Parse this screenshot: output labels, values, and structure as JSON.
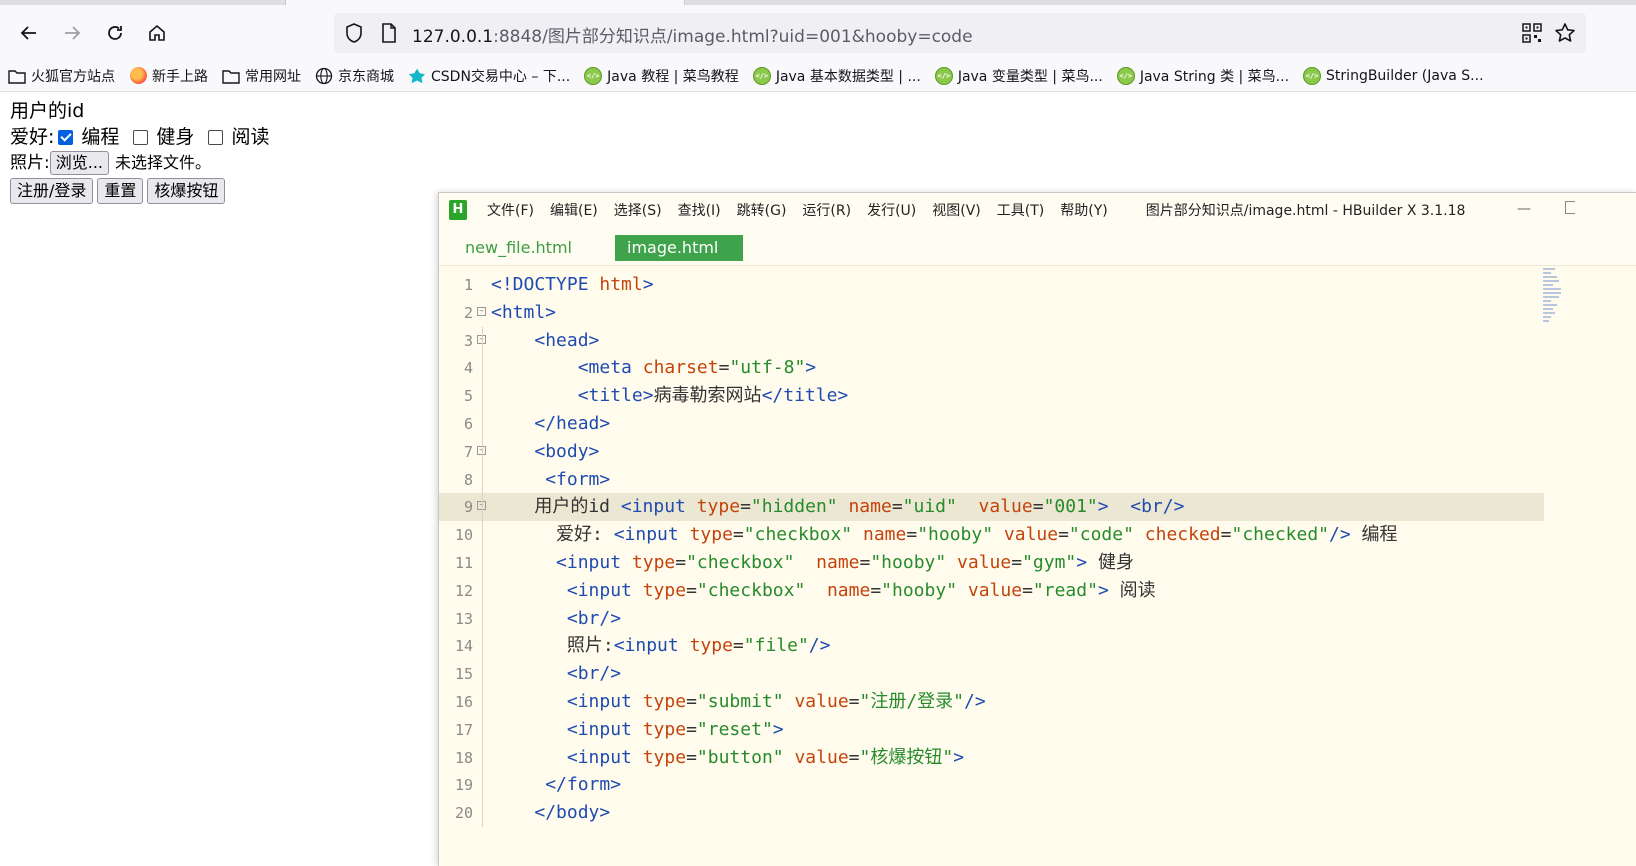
{
  "browser": {
    "url_host": "127.0.0.1",
    "url_rest": ":8848/图片部分知识点/image.html?uid=001&hooby=code",
    "bookmarks": [
      {
        "label": "火狐官方站点",
        "icon": "folder-icon"
      },
      {
        "label": "新手上路",
        "icon": "firefox-icon"
      },
      {
        "label": "常用网址",
        "icon": "folder-icon"
      },
      {
        "label": "京东商城",
        "icon": "globe-icon"
      },
      {
        "label": "CSDN交易中心 – 下...",
        "icon": "csdn-icon"
      },
      {
        "label": "Java 教程 | 菜鸟教程",
        "icon": "runoob-icon"
      },
      {
        "label": "Java 基本数据类型 | ...",
        "icon": "runoob-icon"
      },
      {
        "label": "Java 变量类型 | 菜鸟...",
        "icon": "runoob-icon"
      },
      {
        "label": "Java String 类 | 菜鸟...",
        "icon": "runoob-icon"
      },
      {
        "label": "StringBuilder (Java S...",
        "icon": "runoob-icon"
      }
    ]
  },
  "page": {
    "user_id_label": "用户的id",
    "hobby_label": "爱好:",
    "hobbies": [
      {
        "label": "编程",
        "checked": true
      },
      {
        "label": "健身",
        "checked": false
      },
      {
        "label": "阅读",
        "checked": false
      }
    ],
    "photo_label": "照片:",
    "browse_button": "浏览...",
    "no_file_text": "未选择文件。",
    "submit_button": "注册/登录",
    "reset_button": "重置",
    "nuke_button": "核爆按钮"
  },
  "editor": {
    "logo": "H",
    "menus": [
      "文件(F)",
      "编辑(E)",
      "选择(S)",
      "查找(I)",
      "跳转(G)",
      "运行(R)",
      "发行(U)",
      "视图(V)",
      "工具(T)",
      "帮助(Y)"
    ],
    "window_title": "图片部分知识点/image.html - HBuilder X 3.1.18",
    "minimize_glyph": "—",
    "tabs": [
      "new_file.html",
      "image.html"
    ],
    "active_tab": 1,
    "highlighted_line": 9,
    "code": [
      {
        "n": "1",
        "fold": false,
        "tokens": [
          [
            "tg",
            "<!DOCTYPE "
          ],
          [
            "at",
            "html"
          ],
          [
            "tg",
            ">"
          ]
        ]
      },
      {
        "n": "2",
        "fold": true,
        "tokens": [
          [
            "tg",
            "<html>"
          ]
        ]
      },
      {
        "n": "3",
        "fold": true,
        "tokens": [
          [
            "tx",
            "    "
          ],
          [
            "tg",
            "<head>"
          ]
        ]
      },
      {
        "n": "4",
        "fold": false,
        "tokens": [
          [
            "tx",
            "        "
          ],
          [
            "tg",
            "<meta "
          ],
          [
            "at",
            "charset"
          ],
          [
            "tx",
            "="
          ],
          [
            "st",
            "\"utf-8\""
          ],
          [
            "tg",
            ">"
          ]
        ]
      },
      {
        "n": "5",
        "fold": false,
        "tokens": [
          [
            "tx",
            "        "
          ],
          [
            "tg",
            "<title>"
          ],
          [
            "tx",
            "病毒勒索网站"
          ],
          [
            "tg",
            "</title>"
          ]
        ]
      },
      {
        "n": "6",
        "fold": false,
        "tokens": [
          [
            "tx",
            "    "
          ],
          [
            "tg",
            "</head>"
          ]
        ]
      },
      {
        "n": "7",
        "fold": true,
        "tokens": [
          [
            "tx",
            "    "
          ],
          [
            "tg",
            "<body>"
          ]
        ]
      },
      {
        "n": "8",
        "fold": false,
        "tokens": [
          [
            "tx",
            "     "
          ],
          [
            "tg",
            "<form>"
          ]
        ]
      },
      {
        "n": "9",
        "fold": true,
        "tokens": [
          [
            "tx",
            "    用户的id "
          ],
          [
            "tg",
            "<input "
          ],
          [
            "at",
            "type"
          ],
          [
            "tx",
            "="
          ],
          [
            "st",
            "\"hidden\" "
          ],
          [
            "at",
            "name"
          ],
          [
            "tx",
            "="
          ],
          [
            "st",
            "\"uid\"  "
          ],
          [
            "at",
            "value"
          ],
          [
            "tx",
            "="
          ],
          [
            "st",
            "\"001\""
          ],
          [
            "tg",
            ">  <br/>"
          ]
        ]
      },
      {
        "n": "10",
        "fold": false,
        "tokens": [
          [
            "tx",
            "      爱好: "
          ],
          [
            "tg",
            "<input "
          ],
          [
            "at",
            "type"
          ],
          [
            "tx",
            "="
          ],
          [
            "st",
            "\"checkbox\" "
          ],
          [
            "at",
            "name"
          ],
          [
            "tx",
            "="
          ],
          [
            "st",
            "\"hooby\" "
          ],
          [
            "at",
            "value"
          ],
          [
            "tx",
            "="
          ],
          [
            "st",
            "\"code\" "
          ],
          [
            "at",
            "checked"
          ],
          [
            "tx",
            "="
          ],
          [
            "st",
            "\"checked\""
          ],
          [
            "tg",
            "/>"
          ],
          [
            "tx",
            " 编程"
          ]
        ]
      },
      {
        "n": "11",
        "fold": false,
        "tokens": [
          [
            "tx",
            "      "
          ],
          [
            "tg",
            "<input "
          ],
          [
            "at",
            "type"
          ],
          [
            "tx",
            "="
          ],
          [
            "st",
            "\"checkbox\"  "
          ],
          [
            "at",
            "name"
          ],
          [
            "tx",
            "="
          ],
          [
            "st",
            "\"hooby\" "
          ],
          [
            "at",
            "value"
          ],
          [
            "tx",
            "="
          ],
          [
            "st",
            "\"gym\""
          ],
          [
            "tg",
            ">"
          ],
          [
            "tx",
            " 健身"
          ]
        ]
      },
      {
        "n": "12",
        "fold": false,
        "tokens": [
          [
            "tx",
            "       "
          ],
          [
            "tg",
            "<input "
          ],
          [
            "at",
            "type"
          ],
          [
            "tx",
            "="
          ],
          [
            "st",
            "\"checkbox\"  "
          ],
          [
            "at",
            "name"
          ],
          [
            "tx",
            "="
          ],
          [
            "st",
            "\"hooby\" "
          ],
          [
            "at",
            "value"
          ],
          [
            "tx",
            "="
          ],
          [
            "st",
            "\"read\""
          ],
          [
            "tg",
            ">"
          ],
          [
            "tx",
            " 阅读"
          ]
        ]
      },
      {
        "n": "13",
        "fold": false,
        "tokens": [
          [
            "tx",
            "       "
          ],
          [
            "tg",
            "<br/>"
          ]
        ]
      },
      {
        "n": "14",
        "fold": false,
        "tokens": [
          [
            "tx",
            "       照片:"
          ],
          [
            "tg",
            "<input "
          ],
          [
            "at",
            "type"
          ],
          [
            "tx",
            "="
          ],
          [
            "st",
            "\"file\""
          ],
          [
            "tg",
            "/>"
          ]
        ]
      },
      {
        "n": "15",
        "fold": false,
        "tokens": [
          [
            "tx",
            "       "
          ],
          [
            "tg",
            "<br/>"
          ]
        ]
      },
      {
        "n": "16",
        "fold": false,
        "tokens": [
          [
            "tx",
            "       "
          ],
          [
            "tg",
            "<input "
          ],
          [
            "at",
            "type"
          ],
          [
            "tx",
            "="
          ],
          [
            "st",
            "\"submit\" "
          ],
          [
            "at",
            "value"
          ],
          [
            "tx",
            "="
          ],
          [
            "st",
            "\"注册/登录\""
          ],
          [
            "tg",
            "/>"
          ]
        ]
      },
      {
        "n": "17",
        "fold": false,
        "tokens": [
          [
            "tx",
            "       "
          ],
          [
            "tg",
            "<input "
          ],
          [
            "at",
            "type"
          ],
          [
            "tx",
            "="
          ],
          [
            "st",
            "\"reset\""
          ],
          [
            "tg",
            ">"
          ]
        ]
      },
      {
        "n": "18",
        "fold": false,
        "tokens": [
          [
            "tx",
            "       "
          ],
          [
            "tg",
            "<input "
          ],
          [
            "at",
            "type"
          ],
          [
            "tx",
            "="
          ],
          [
            "st",
            "\"button\" "
          ],
          [
            "at",
            "value"
          ],
          [
            "tx",
            "="
          ],
          [
            "st",
            "\"核爆按钮\""
          ],
          [
            "tg",
            ">"
          ]
        ]
      },
      {
        "n": "19",
        "fold": false,
        "tokens": [
          [
            "tx",
            "     "
          ],
          [
            "tg",
            "</form>"
          ]
        ]
      },
      {
        "n": "20",
        "fold": false,
        "tokens": [
          [
            "tx",
            "    "
          ],
          [
            "tg",
            "</body>"
          ]
        ]
      }
    ]
  }
}
